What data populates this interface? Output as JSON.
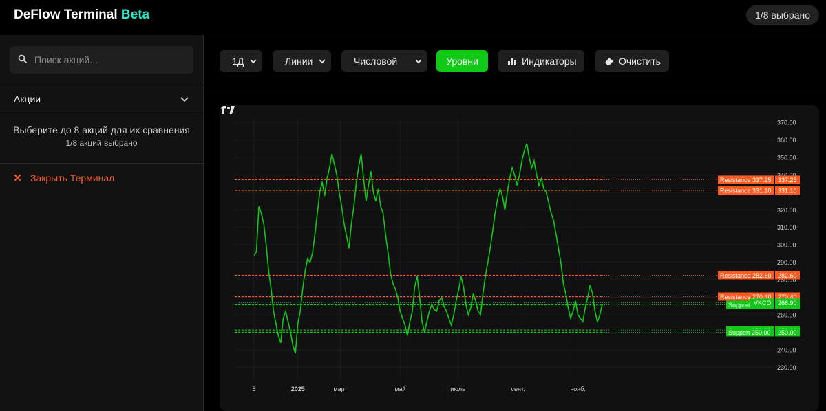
{
  "app": {
    "title": "DeFlow Terminal",
    "badge": "Beta",
    "selected_count": "1/8 выбрано"
  },
  "sidebar": {
    "search_placeholder": "Поиск акций...",
    "stocks_label": "Акции",
    "hint": "Выберите до 8 акций для их сравнения",
    "hint_count": "1/8 акций выбрано",
    "close_label": "Закрыть Терминал"
  },
  "toolbar": {
    "interval": "1Д",
    "chart_type": "Линии",
    "scale": "Числовой",
    "levels": "Уровни",
    "indicators": "Индикаторы",
    "clear": "Очистить"
  },
  "colors": {
    "accent": "#10c916",
    "resistance": "#ff5a1f",
    "support": "#10c916",
    "danger": "#ff5a2c",
    "beta": "#2ee6c8"
  },
  "chart_data": {
    "type": "line",
    "symbol": "VKCO",
    "last_price": "266.90",
    "ylim": [
      225,
      372
    ],
    "y_ticks": [
      "370.00",
      "360.00",
      "350.00",
      "340.00",
      "330.00",
      "320.00",
      "310.00",
      "300.00",
      "290.00",
      "280.00",
      "270.00",
      "260.00",
      "250.00",
      "240.00",
      "230.00"
    ],
    "x_ticks": [
      {
        "label": "5",
        "t": 0.0
      },
      {
        "label": "2025",
        "t": 0.126,
        "bold": true
      },
      {
        "label": "март",
        "t": 0.248
      },
      {
        "label": "май",
        "t": 0.42
      },
      {
        "label": "июль",
        "t": 0.585
      },
      {
        "label": "сент.",
        "t": 0.758
      },
      {
        "label": "нояб.",
        "t": 0.93
      }
    ],
    "levels": [
      {
        "kind": "resistance",
        "label": "Resistance 337.25",
        "price": "337.25",
        "value": 337.25
      },
      {
        "kind": "resistance",
        "label": "Resistance 331.10",
        "price": "331.10",
        "value": 331.1
      },
      {
        "kind": "resistance",
        "label": "Resistance 282.60",
        "price": "282.60",
        "value": 282.6
      },
      {
        "kind": "resistance",
        "label": "Resistance 270.40",
        "price": "270.40",
        "value": 270.4
      },
      {
        "kind": "support",
        "label": "Support 265.65",
        "price": "265.65",
        "value": 265.65
      },
      {
        "kind": "support",
        "label": "Support 251.30",
        "price": "251.30",
        "value": 251.3
      },
      {
        "kind": "support",
        "label": "Support 250.00",
        "price": "250.00",
        "value": 250.0
      }
    ],
    "series": [
      {
        "values": [
          294,
          296,
          322,
          318,
          312,
          300,
          285,
          275,
          262,
          255,
          248,
          244,
          258,
          262,
          256,
          250,
          242,
          238,
          255,
          262,
          275,
          285,
          292,
          290,
          295,
          306,
          318,
          330,
          336,
          328,
          338,
          344,
          352,
          346,
          340,
          330,
          322,
          312,
          305,
          298,
          312,
          322,
          335,
          345,
          352,
          338,
          325,
          334,
          342,
          330,
          325,
          332,
          322,
          318,
          306,
          296,
          284,
          278,
          275,
          270,
          262,
          258,
          254,
          248,
          256,
          262,
          276,
          282,
          270,
          256,
          250,
          256,
          262,
          266,
          263,
          262,
          268,
          270,
          265,
          262,
          258,
          254,
          260,
          268,
          274,
          282,
          276,
          266,
          260,
          264,
          272,
          268,
          262,
          260,
          272,
          282,
          290,
          298,
          308,
          318,
          326,
          332,
          328,
          320,
          330,
          338,
          344,
          340,
          334,
          340,
          348,
          354,
          358,
          350,
          344,
          348,
          340,
          334,
          338,
          332,
          330,
          324,
          318,
          314,
          306,
          298,
          290,
          278,
          272,
          264,
          258,
          262,
          268,
          260,
          258,
          256,
          264,
          270,
          277,
          272,
          262,
          256,
          260,
          266
        ],
        "color": "#10c916"
      }
    ]
  }
}
